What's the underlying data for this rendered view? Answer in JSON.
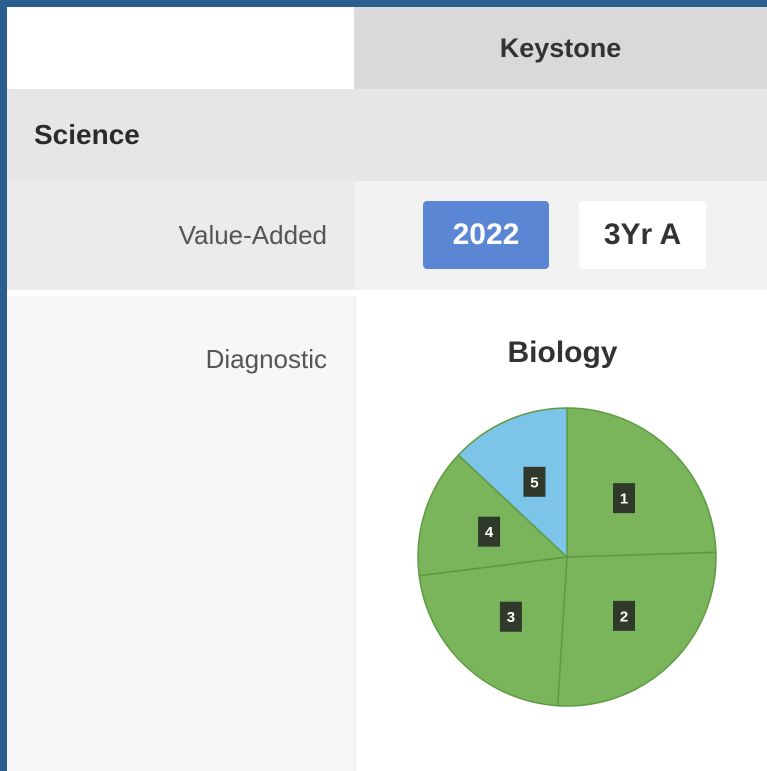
{
  "header": {
    "column": "Keystone"
  },
  "section": {
    "title": "Science"
  },
  "value_added": {
    "label": "Value-Added",
    "buttons": [
      {
        "label": "2022",
        "active": true
      },
      {
        "label": "3Yr A",
        "active": false
      }
    ]
  },
  "diagnostic": {
    "label": "Diagnostic"
  },
  "colors": {
    "frame": "#2c5d8f",
    "active_button": "#5b86d4",
    "slice_green": "#7ab55c",
    "slice_blue": "#7cc4e8",
    "label_box": "#2f3a2a"
  },
  "chart_data": {
    "type": "pie",
    "title": "Biology",
    "slices": [
      {
        "label": "1",
        "value": 24.5,
        "color": "#7ab55c"
      },
      {
        "label": "2",
        "value": 26.5,
        "color": "#7ab55c"
      },
      {
        "label": "3",
        "value": 22.0,
        "color": "#7ab55c"
      },
      {
        "label": "4",
        "value": 14.0,
        "color": "#7ab55c"
      },
      {
        "label": "5",
        "value": 13.0,
        "color": "#7cc4e8"
      }
    ]
  }
}
